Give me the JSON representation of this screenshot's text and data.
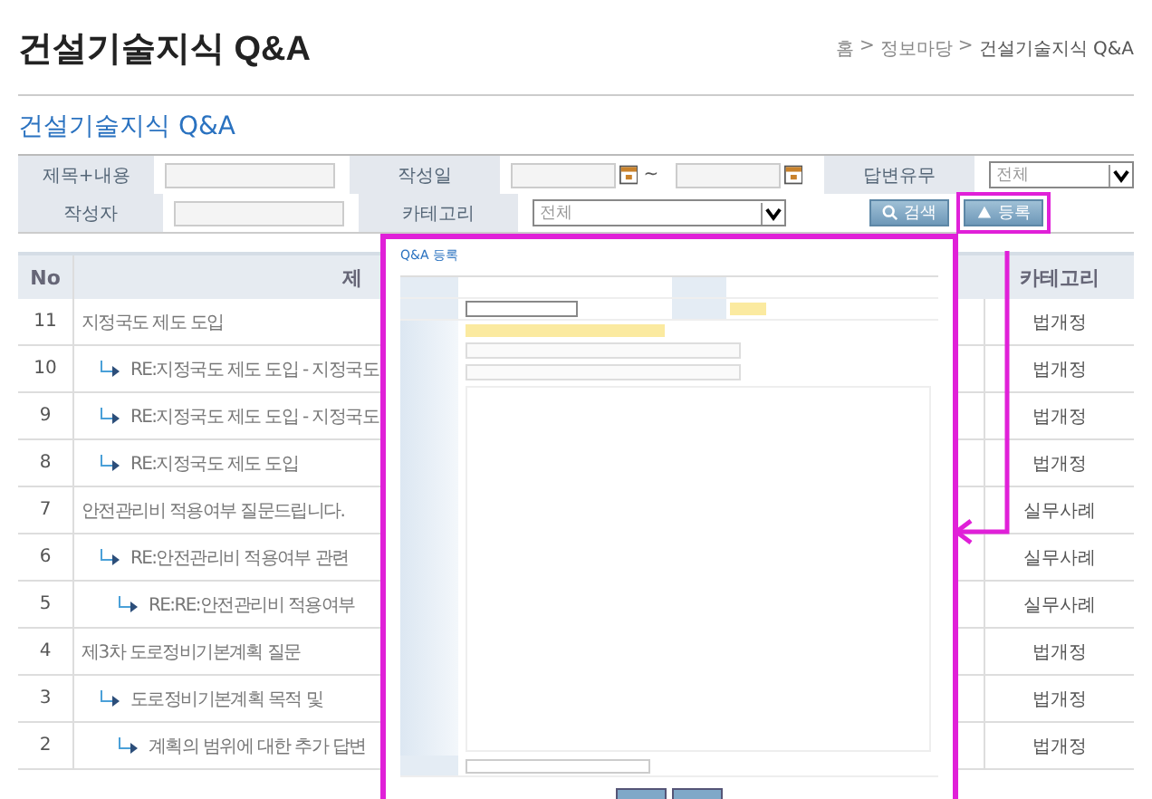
{
  "page_title": "건설기술지식 Q&A",
  "breadcrumb": [
    "홈",
    "정보마당",
    "건설기술지식 Q&A"
  ],
  "breadcrumb_separator": ">",
  "section_title": "건설기술지식 Q&A",
  "search": {
    "title_label": "제목+내용",
    "date_label": "작성일",
    "date_separator": "~",
    "answer_label": "답변유무",
    "answer_value": "전체",
    "author_label": "작성자",
    "category_label": "카테고리",
    "category_value": "전체",
    "search_button": "검색",
    "register_button": "등록"
  },
  "table": {
    "columns": [
      "No",
      "제",
      "카테고리"
    ],
    "rows": [
      {
        "no": "11",
        "title": "지정국도 제도 도입",
        "category": "법개정",
        "children": [
          {
            "no": "10",
            "title": "RE:지정국도 제도 도입 - 지정국도",
            "category": "법개정"
          },
          {
            "no": "9",
            "title": "RE:지정국도 제도 도입 - 지정국도",
            "category": "법개정"
          },
          {
            "no": "8",
            "title": "RE:지정국도 제도 도입",
            "category": "법개정"
          }
        ]
      },
      {
        "no": "7",
        "title": "안전관리비 적용여부 질문드립니다.",
        "category": "실무사례",
        "children": [
          {
            "no": "6",
            "title": "RE:안전관리비 적용여부 관련",
            "category": "실무사례",
            "children": [
              {
                "no": "5",
                "title": "RE:RE:안전관리비 적용여부",
                "category": "실무사례"
              }
            ]
          }
        ]
      },
      {
        "no": "4",
        "title": "제3차 도로정비기본계획 질문",
        "category": "법개정",
        "children": [
          {
            "no": "3",
            "title": "도로정비기본계획 목적 및",
            "category": "법개정",
            "children": [
              {
                "no": "2",
                "title": "계획의 범위에 대한 추가 답변",
                "category": "법개정"
              }
            ]
          }
        ]
      }
    ]
  },
  "dialog": {
    "title": "Q&A 등록"
  }
}
